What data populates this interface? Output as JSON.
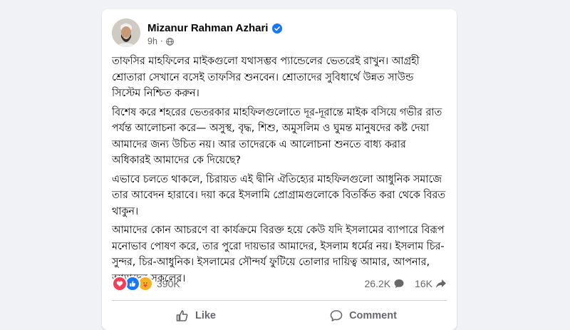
{
  "post": {
    "author": "Mizanur Rahman Azhari",
    "time": "9h",
    "paragraphs": [
      "তাফসির মাহফিলের মাইকগুলো যথাসম্ভব প্যান্ডেলের ভেতরেই রাখুন। আগ্রহী শ্রোতারা সেখানে বসেই তাফসির শুনবেন। শ্রোতাদের সুবিধার্থে উন্নত সাউন্ড সিস্টেম নিশ্চিত করুন।",
      "বিশেষ করে শহরের ভেতরকার মাহফিলগুলোতে দূর-দূরান্তে মাইক বসিয়ে গভীর রাত পর্যন্ত আলোচনা করে— অসুস্থ, বৃদ্ধ, শিশু, অমুসলিম ও ঘুমন্ত মানুষদের কষ্ট দেয়া আমাদের জন্য উচিত নয়। আর তাদেরকে এ আলোচনা শুনতে বাধ্য করার অধিকারই আমাদের কে দিয়েছে?",
      "এভাবে চলতে থাকলে, চিরায়ত এই দ্বীনি ঐতিহ্যের মাহফিলগুলো আধুনিক সমাজে তার আবেদন হারাবে। দয়া করে ইসলামি প্রোগ্রামগুলোকে বিতর্কিত করা থেকে বিরত থাকুন।",
      "আমাদের কোন আচরণে বা কার্যক্রমে বিরক্ত হয়ে কেউ যদি ইসলামের ব্যাপারে বিরূপ মনোভাব পোষণ করে, তার পুরো দায়ভার আমাদের, ইসলাম ধর্মের নয়। ইসলাম চির-সুন্দর, চির-আধুনিক। ইসলামের সৌন্দর্য ফুটিয়ে তোলার দায়িত্ব আমার, আপনার, আমাদের সকলের।"
    ]
  },
  "stats": {
    "reactions": "390K",
    "comments": "26.2K",
    "shares": "16K"
  },
  "actions": {
    "like": "Like",
    "comment": "Comment"
  },
  "icons": {
    "verified": "verified-badge-icon",
    "globe": "globe-icon",
    "love": "love-reaction-icon",
    "like": "like-reaction-icon",
    "care": "care-reaction-icon",
    "comment": "comment-icon",
    "share": "share-icon"
  },
  "colors": {
    "verified": "#1877f2",
    "love": "#f33e58",
    "like": "#1877f2",
    "care": "#f7b125"
  }
}
